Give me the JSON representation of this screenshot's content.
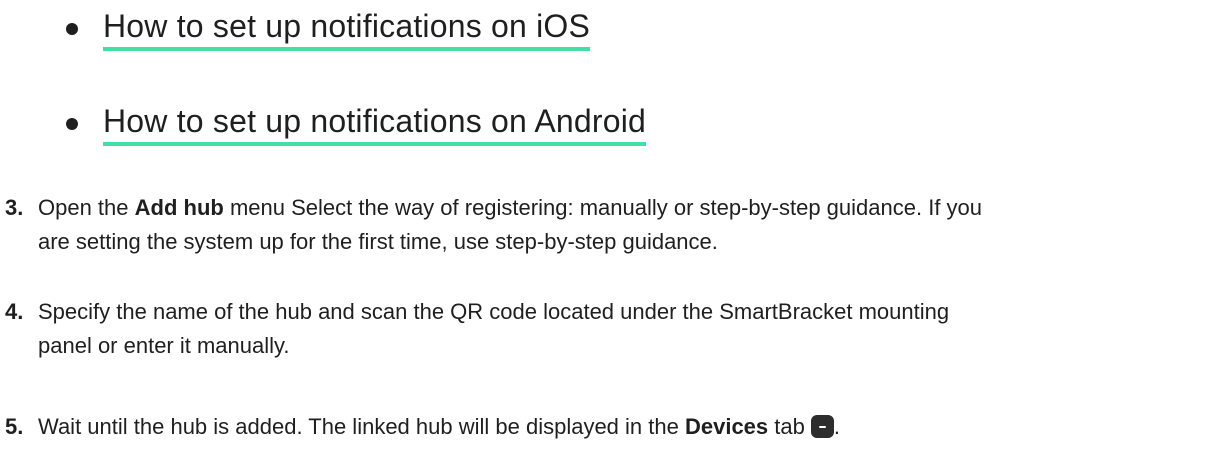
{
  "links": [
    {
      "label": "How to set up notifications on iOS"
    },
    {
      "label": "How to set up notifications on Android"
    }
  ],
  "steps": {
    "s3": {
      "number": "3.",
      "part1": "Open the ",
      "bold1": "Add hub",
      "part2": " menu Select the way of registering: manually or step-by-step guidance. If you",
      "line2": "are setting the system up for the first time, use step-by-step guidance."
    },
    "s4": {
      "number": "4.",
      "line1": "Specify the name of the hub and scan the QR code located under the SmartBracket mounting",
      "line2": "panel or enter it manually."
    },
    "s5": {
      "number": "5.",
      "part1": "Wait until the hub is added. The linked hub will be displayed in the ",
      "bold1": "Devices",
      "part2": " tab",
      "end": "."
    }
  },
  "colors": {
    "link_underline": "#3fe0a3",
    "text": "#1f1f1f",
    "icon_bg": "#2d2d2d"
  },
  "icons": {
    "devices_tab": "devices-tab-icon"
  }
}
